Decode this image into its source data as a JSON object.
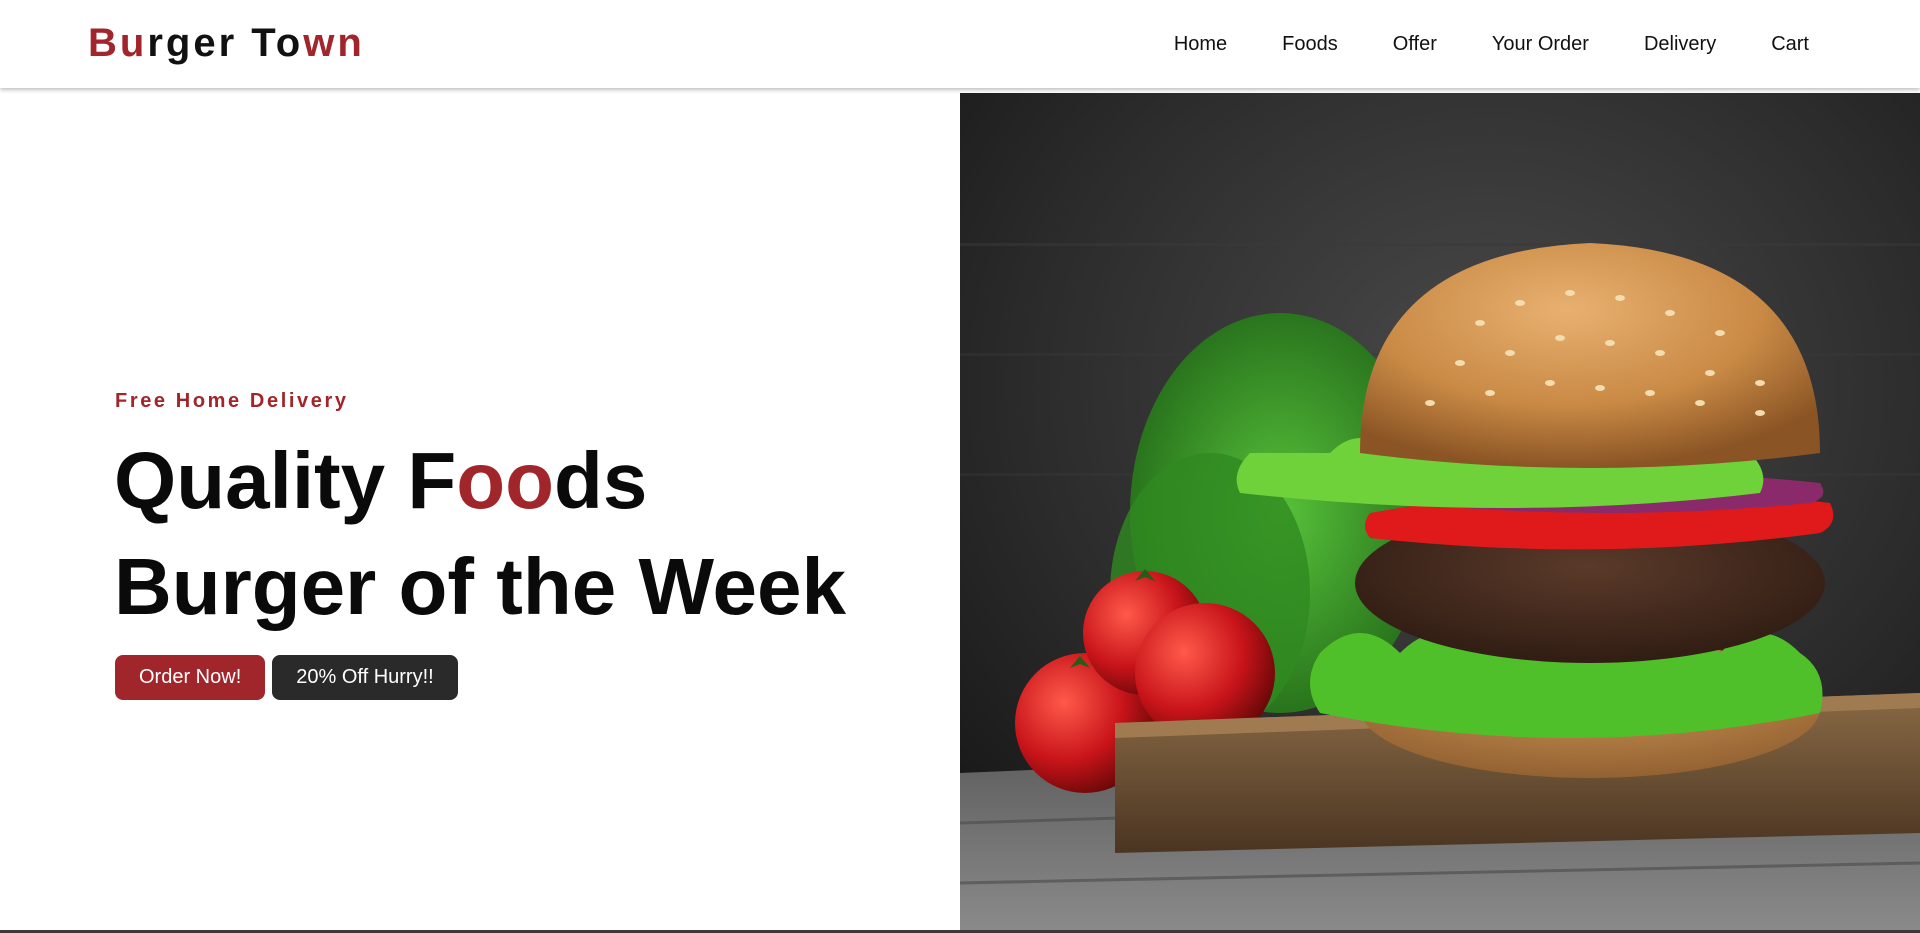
{
  "header": {
    "logo": {
      "letters": [
        {
          "char": "B",
          "color": "#a1262b"
        },
        {
          "char": "u",
          "color": "#a1262b"
        },
        {
          "char": "r",
          "color": "#111111"
        },
        {
          "char": "g",
          "color": "#111111"
        },
        {
          "char": "e",
          "color": "#111111"
        },
        {
          "char": "r",
          "color": "#111111"
        },
        {
          "char": " ",
          "color": "#111111"
        },
        {
          "char": "T",
          "color": "#111111"
        },
        {
          "char": "o",
          "color": "#111111"
        },
        {
          "char": "w",
          "color": "#a1262b"
        },
        {
          "char": "n",
          "color": "#a1262b"
        }
      ]
    },
    "nav": [
      {
        "label": "Home"
      },
      {
        "label": "Foods"
      },
      {
        "label": "Offer"
      },
      {
        "label": "Your Order"
      },
      {
        "label": "Delivery"
      },
      {
        "label": "Cart"
      }
    ]
  },
  "hero": {
    "tagline": "Free Home Delivery",
    "headline_line1": {
      "before": "Quality F",
      "highlight": "oo",
      "after": "ds"
    },
    "headline_line2": "Burger of the Week",
    "primary_button": "Order Now!",
    "secondary_button": "20% Off Hurry!!",
    "image_subject": "burger-photo"
  },
  "colors": {
    "accent": "#a1262b",
    "dark_button": "#2a2a2a",
    "text": "#0a0a0a"
  }
}
